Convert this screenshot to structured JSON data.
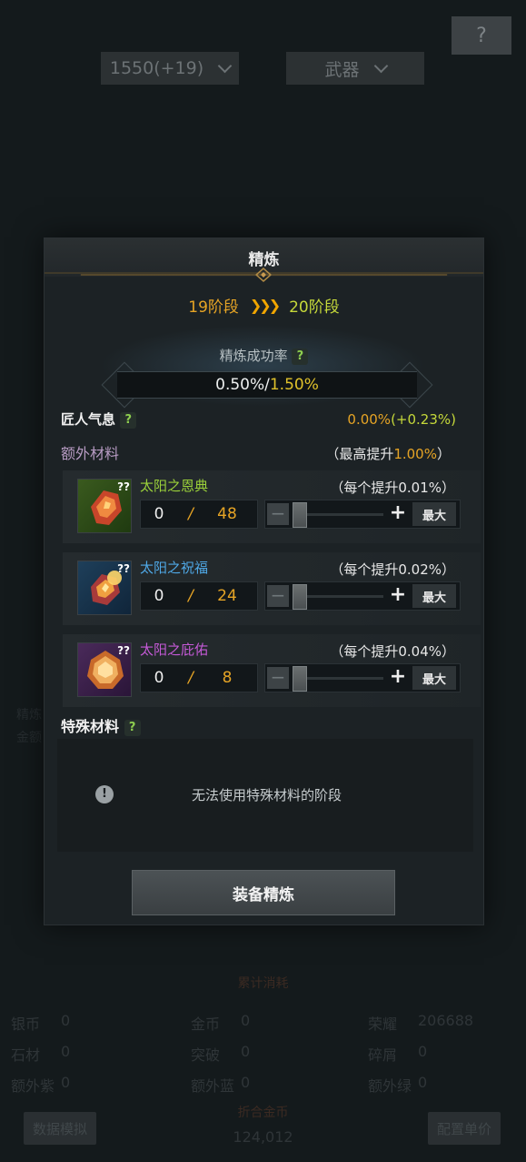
{
  "background": {
    "help_label": "?",
    "level_dropdown": "1550(+19)",
    "type_dropdown": "武器",
    "ghost_left_1": "精炼",
    "ghost_left_2": "金额",
    "stats_header": "累计消耗",
    "stats": [
      {
        "label": "银币",
        "value": "0"
      },
      {
        "label": "金币",
        "value": "0"
      },
      {
        "label": "荣耀",
        "value": "206688"
      },
      {
        "label": "石材",
        "value": "0"
      },
      {
        "label": "突破",
        "value": "0"
      },
      {
        "label": "碎屑",
        "value": "0"
      },
      {
        "label": "额外紫",
        "value": "0"
      },
      {
        "label": "额外蓝",
        "value": "0"
      },
      {
        "label": "额外绿",
        "value": "0"
      }
    ],
    "total_label": "折合金币",
    "total_value": "124,012",
    "simulate_button": "数据模拟",
    "config_button": "配置单价"
  },
  "modal": {
    "title": "精炼",
    "stage_from": "19阶段",
    "stage_arrows": "❯❯❯",
    "stage_to": "20阶段",
    "success_rate_label": "精炼成功率",
    "success_rate_current": "0.50%/",
    "success_rate_max": "1.50%",
    "artisan_label": "匠人气息",
    "artisan_value": "0.00%",
    "artisan_bonus": "(+0.23%)",
    "extra_materials_label": "额外材料",
    "extra_max_prefix": "（最高提升",
    "extra_max_value": "1.00%",
    "extra_max_suffix": "）",
    "help_mark": "?",
    "materials": [
      {
        "name": "太阳之恩典",
        "color": "#9bd13a",
        "bonus": "（每个提升0.01%）",
        "have": "0",
        "sep": "/",
        "need": "48",
        "icon_badge": "??",
        "slider_fraction": 0
      },
      {
        "name": "太阳之祝福",
        "color": "#4fa8e6",
        "bonus": "（每个提升0.02%）",
        "have": "0",
        "sep": "/",
        "need": "24",
        "icon_badge": "??",
        "slider_fraction": 0
      },
      {
        "name": "太阳之庇佑",
        "color": "#c65ad8",
        "bonus": "（每个提升0.04%）",
        "have": "0",
        "sep": "/",
        "need": "8",
        "icon_badge": "??",
        "slider_fraction": 0
      }
    ],
    "minus_label": "−",
    "plus_label": "+",
    "max_label": "最大",
    "special_label": "特殊材料",
    "warn_icon": "!",
    "special_message": "无法使用特殊材料的阶段",
    "refine_button": "装备精炼"
  }
}
